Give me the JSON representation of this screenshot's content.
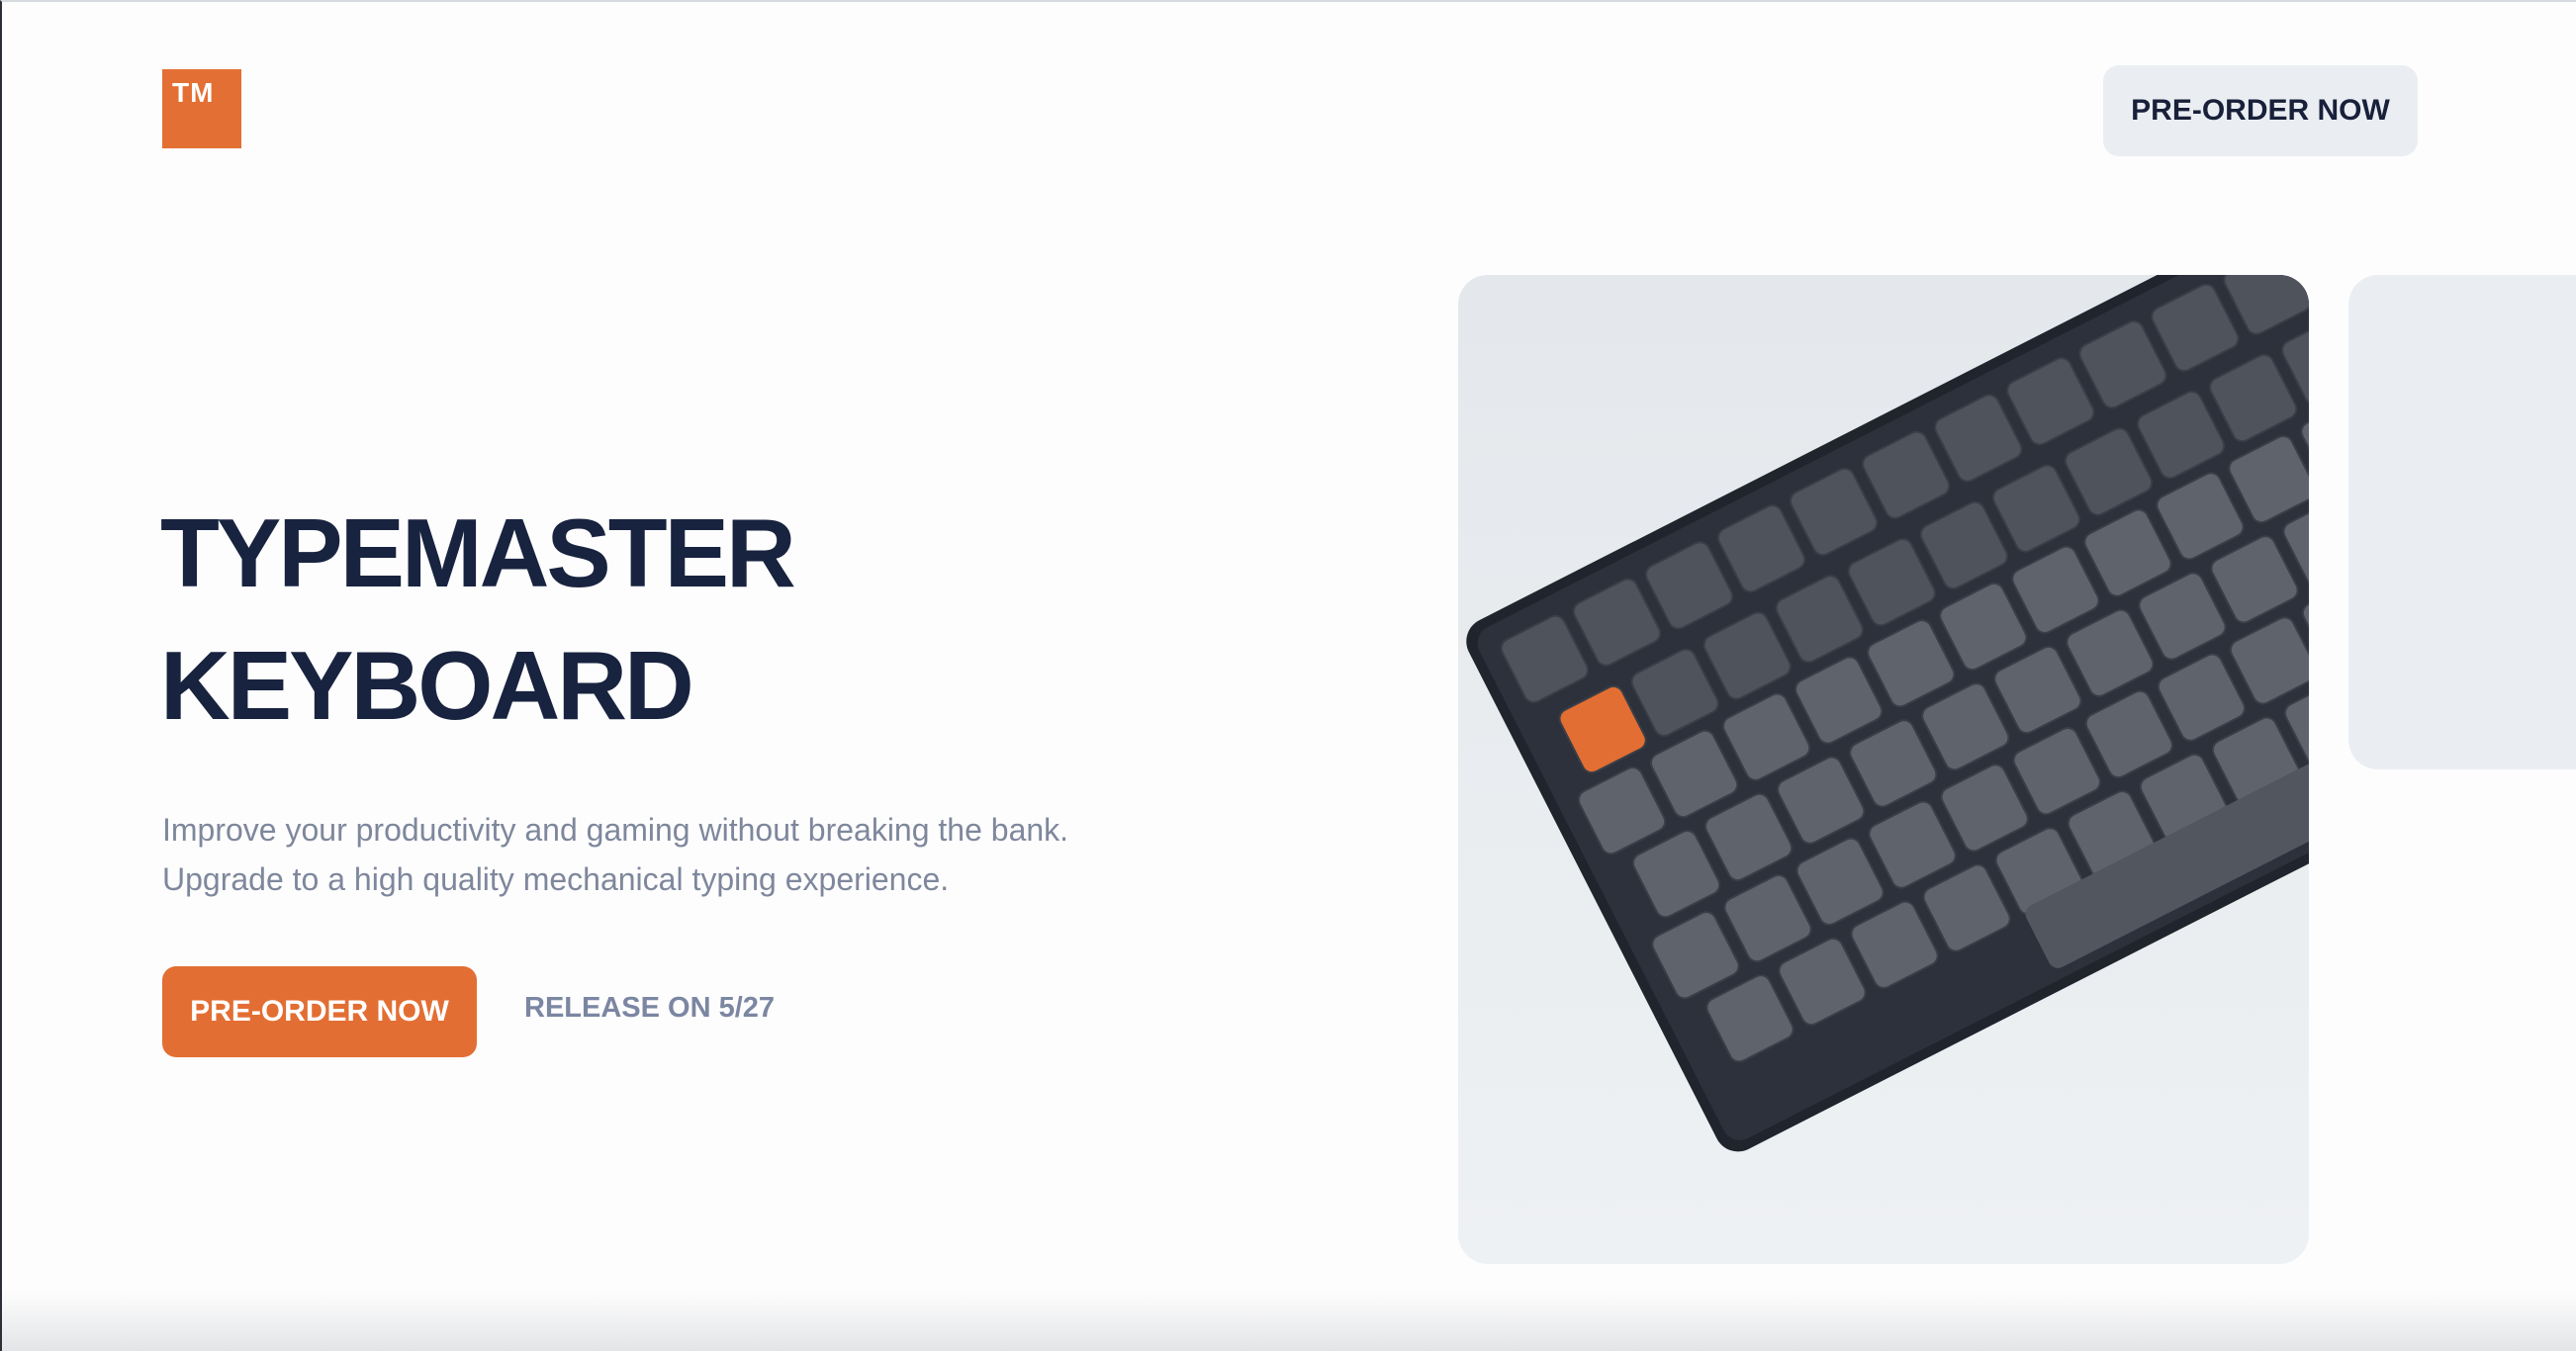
{
  "header": {
    "logo_text": "TM",
    "cta_label": "PRE-ORDER NOW"
  },
  "hero": {
    "title_line1": "TYPEMASTER",
    "title_line2": "KEYBOARD",
    "subtitle_line1": "Improve your productivity and gaming without breaking the bank.",
    "subtitle_line2": "Upgrade to a high quality mechanical typing experience.",
    "cta_label": "PRE-ORDER NOW",
    "release_text": "RELEASE ON 5/27"
  },
  "colors": {
    "accent": "#e36e33",
    "heading": "#18233f",
    "muted": "#7e879c",
    "card_bg": "#eaeef2"
  }
}
